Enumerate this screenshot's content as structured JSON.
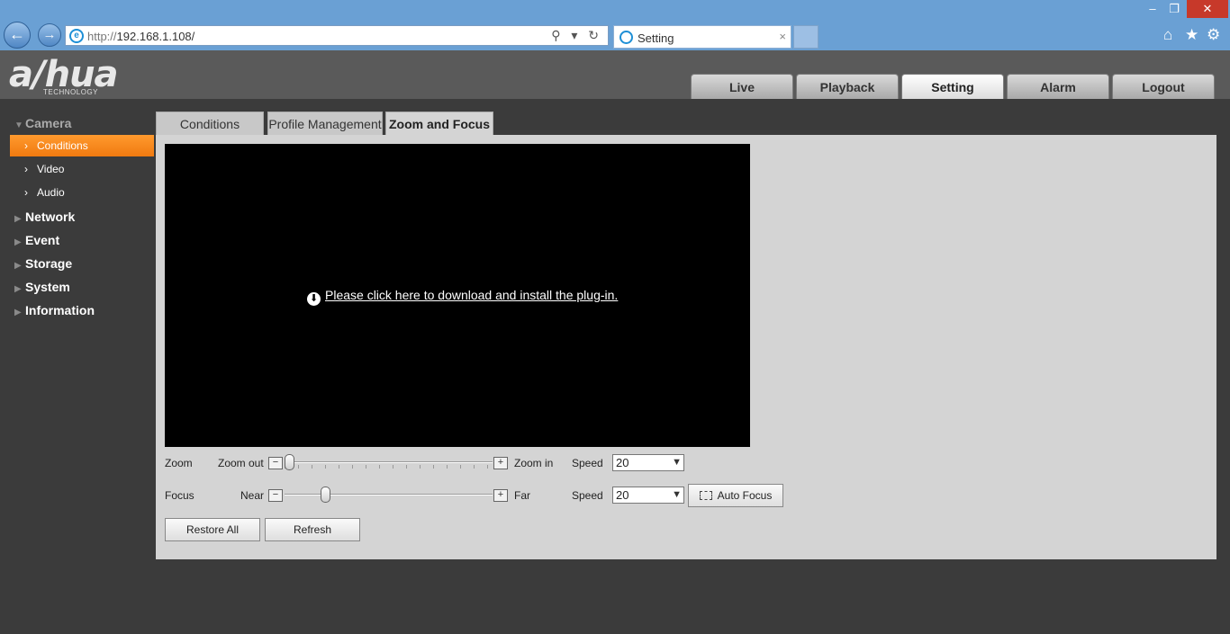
{
  "browser": {
    "back_icon": "back-arrow-icon",
    "forward_icon": "forward-arrow-icon",
    "url_scheme": "http://",
    "url_host": "192.168.1.108/",
    "address_icons": "⚲ ▾ ↻",
    "tab_title": "Setting",
    "tab_close": "×",
    "window_controls": {
      "minimize": "–",
      "restore": "❐",
      "close": "✕"
    },
    "toolbar": {
      "home": "⌂",
      "favorites": "★",
      "tools": "⚙"
    }
  },
  "header": {
    "logo_text": "a/hua",
    "logo_subtitle": "TECHNOLOGY",
    "tabs": [
      {
        "label": "Live"
      },
      {
        "label": "Playback"
      },
      {
        "label": "Setting",
        "active": true
      },
      {
        "label": "Alarm"
      },
      {
        "label": "Logout"
      }
    ]
  },
  "sidebar": {
    "groups": [
      {
        "label": "Camera",
        "open": true
      },
      {
        "label": "Network"
      },
      {
        "label": "Event"
      },
      {
        "label": "Storage"
      },
      {
        "label": "System"
      },
      {
        "label": "Information"
      }
    ],
    "camera_items": [
      {
        "label": "Conditions",
        "active": true
      },
      {
        "label": "Video"
      },
      {
        "label": "Audio"
      }
    ]
  },
  "content": {
    "tabs": [
      {
        "label": "Conditions"
      },
      {
        "label": "Profile Management"
      },
      {
        "label": "Zoom and Focus",
        "active": true
      }
    ],
    "plugin_link": "Please click here to download and install the plug-in.",
    "zoom": {
      "label": "Zoom",
      "min_label": "Zoom out",
      "max_label": "Zoom in",
      "slider_fraction": 0.0,
      "speed_label": "Speed",
      "speed_value": "20"
    },
    "focus": {
      "label": "Focus",
      "min_label": "Near",
      "max_label": "Far",
      "slider_fraction": 0.18,
      "speed_label": "Speed",
      "speed_value": "20",
      "auto_focus_label": "Auto Focus"
    },
    "buttons": {
      "restore_all": "Restore All",
      "refresh": "Refresh"
    },
    "minus": "−",
    "plus": "+",
    "dropdown_arrow": "▼"
  },
  "colors": {
    "accent": "#f07a10",
    "chrome": "#6aa0d4",
    "background": "#3b3b3b"
  }
}
